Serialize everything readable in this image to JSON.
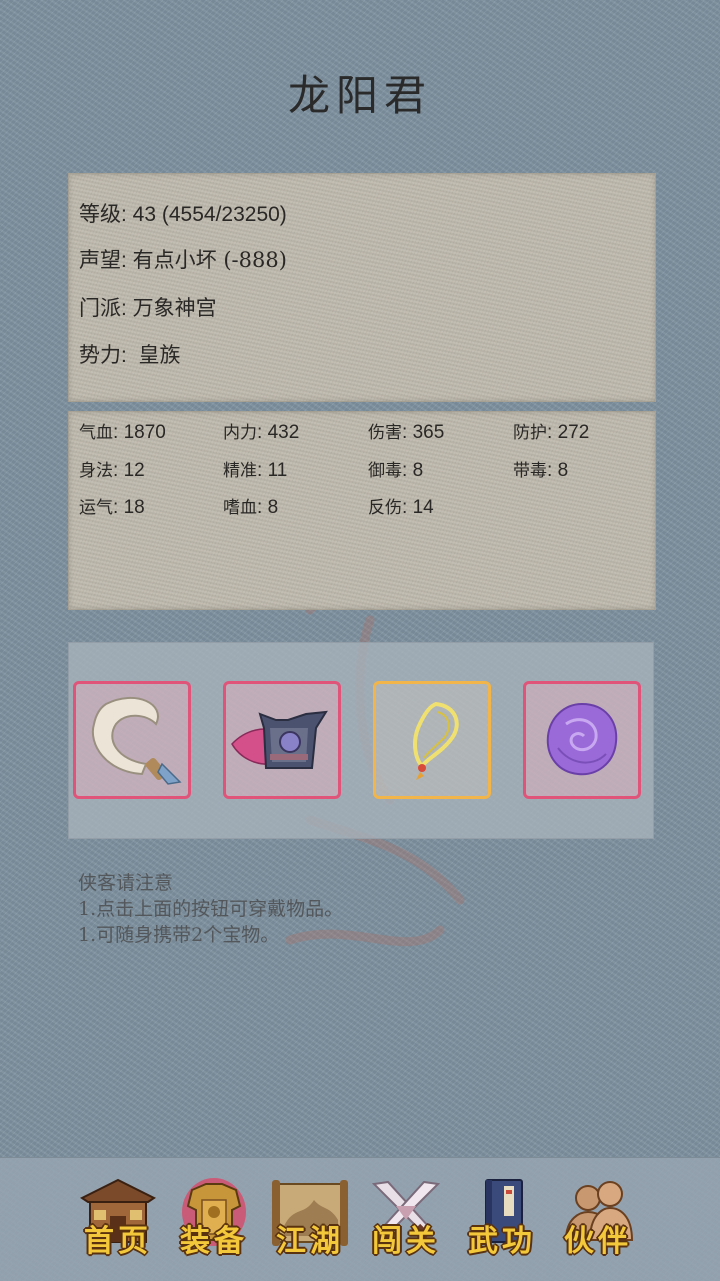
{
  "character": {
    "name": "龙阳君"
  },
  "info": {
    "level_label": "等级",
    "level_value": "43 (4554/23250)",
    "reputation_label": "声望",
    "reputation_value": "有点小坏 (-888)",
    "sect_label": "门派",
    "sect_value": "万象神宫",
    "faction_label": "势力",
    "faction_value": "皇族"
  },
  "stats": [
    {
      "label": "气血",
      "value": "1870"
    },
    {
      "label": "内力",
      "value": "432"
    },
    {
      "label": "伤害",
      "value": "365"
    },
    {
      "label": "防护",
      "value": "272"
    },
    {
      "label": "身法",
      "value": "12"
    },
    {
      "label": "精准",
      "value": "11"
    },
    {
      "label": "御毒",
      "value": "8"
    },
    {
      "label": "带毒",
      "value": "8"
    },
    {
      "label": "运气",
      "value": "18"
    },
    {
      "label": "嗜血",
      "value": "8"
    },
    {
      "label": "反伤",
      "value": "14"
    }
  ],
  "equipment": [
    {
      "icon": "hook-blade-icon",
      "rarity_color": "#e0547a"
    },
    {
      "icon": "winged-armor-icon",
      "rarity_color": "#e0547a"
    },
    {
      "icon": "gold-necklace-icon",
      "rarity_color": "#f2b54a"
    },
    {
      "icon": "purple-orb-icon",
      "rarity_color": "#e0547a"
    }
  ],
  "notice": {
    "title": "侠客请注意",
    "line1": "1.点击上面的按钮可穿戴物品。",
    "line2": "1.可随身携带2个宝物。"
  },
  "nav": [
    {
      "label": "首页",
      "icon": "house-icon"
    },
    {
      "label": "装备",
      "icon": "armor-icon",
      "active": true
    },
    {
      "label": "江湖",
      "icon": "scroll-map-icon"
    },
    {
      "label": "闯关",
      "icon": "crossed-swords-icon"
    },
    {
      "label": "武功",
      "icon": "book-icon"
    },
    {
      "label": "伙伴",
      "icon": "companions-icon"
    }
  ]
}
